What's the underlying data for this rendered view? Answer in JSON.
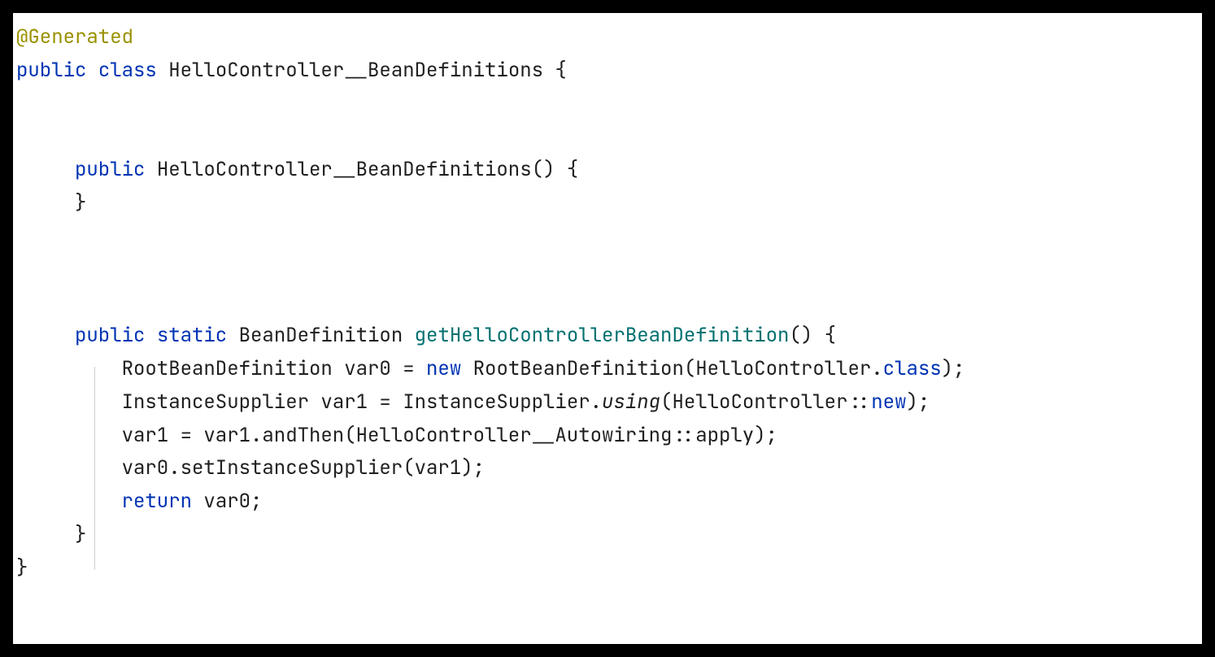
{
  "code": {
    "annotation": "@Generated",
    "class_visibility": "public",
    "class_keyword": "class",
    "class_name": "HelloController__BeanDefinitions",
    "constructor": {
      "visibility": "public",
      "name": "HelloController__BeanDefinitions"
    },
    "method": {
      "visibility": "public",
      "static": "static",
      "return_type": "BeanDefinition",
      "name": "getHelloControllerBeanDefinition",
      "body": {
        "line1_type": "RootBeanDefinition",
        "line1_var": "var0",
        "line1_new": "new",
        "line1_ctor": "RootBeanDefinition",
        "line1_arg_class": "HelloController",
        "line1_class_kw": "class",
        "line2_type": "InstanceSupplier",
        "line2_var": "var1",
        "line2_class": "InstanceSupplier",
        "line2_method": "using",
        "line2_arg_class": "HelloController",
        "line2_new": "new",
        "line3_text": "var1 = var1.andThen(HelloController__Autowiring::apply);",
        "line4_text": "var0.setInstanceSupplier(var1);",
        "line5_return": "return",
        "line5_var": "var0"
      }
    }
  }
}
